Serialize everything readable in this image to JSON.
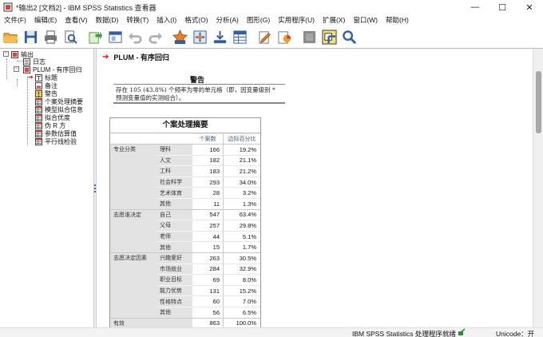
{
  "window": {
    "title": "*输出2 [文档2] - IBM SPSS Statistics 查看器",
    "minimize": "—",
    "maximize": "☐",
    "close": "✕"
  },
  "menu": [
    "文件(F)",
    "编辑(E)",
    "查看(V)",
    "数据(D)",
    "转换(T)",
    "插入(I)",
    "格式(O)",
    "分析(A)",
    "图形(G)",
    "实用程序(U)",
    "扩展(X)",
    "窗口(W)",
    "帮助(H)"
  ],
  "toolbar": [
    "open-icon",
    "save-icon",
    "print-icon",
    "print-preview-icon",
    "export-icon",
    "recall-dialog-icon",
    "undo-icon",
    "redo-icon",
    "goto-data-icon",
    "goto-variable-icon",
    "insert-cases-icon",
    "variables-icon",
    "designate-window-icon",
    "insert-chart-icon",
    "show-all-icon",
    "select-output-icon",
    "find-icon"
  ],
  "outline": {
    "root": "输出",
    "log": "日志",
    "plum": "PLUM - 有序回归",
    "items": [
      "标题",
      "备注",
      "警告",
      "个案处理摘要",
      "模型拟合信息",
      "拟合优度",
      "伪 R 方",
      "参数估算值",
      "平行线检验"
    ]
  },
  "content": {
    "heading": "PLUM - 有序回归",
    "warning_title": "警告",
    "warning_text": "存在 105 (43.8%) 个频率为零的单元格（即，因变量级别 * 预测变量值的实测组合）。",
    "table": {
      "title": "个案处理摘要",
      "col_n": "个案数",
      "col_pct": "边际百分比",
      "groups": [
        {
          "label": "专业分类",
          "rows": [
            [
              "理科",
              "166",
              "19.2%"
            ],
            [
              "人文",
              "182",
              "21.1%"
            ],
            [
              "工科",
              "183",
              "21.2%"
            ],
            [
              "社会科学",
              "293",
              "34.0%"
            ],
            [
              "艺术体育",
              "28",
              "3.2%"
            ],
            [
              "其他",
              "11",
              "1.3%"
            ]
          ]
        },
        {
          "label": "志愿谁决定",
          "rows": [
            [
              "自己",
              "547",
              "63.4%"
            ],
            [
              "父母",
              "257",
              "29.8%"
            ],
            [
              "老师",
              "44",
              "5.1%"
            ],
            [
              "其他",
              "15",
              "1.7%"
            ]
          ]
        },
        {
          "label": "志愿决定因素",
          "rows": [
            [
              "兴趣爱好",
              "263",
              "30.5%"
            ],
            [
              "市场就业",
              "284",
              "32.9%"
            ],
            [
              "职业目标",
              "69",
              "8.0%"
            ],
            [
              "能力优势",
              "131",
              "15.2%"
            ],
            [
              "性格特点",
              "60",
              "7.0%"
            ],
            [
              "其他",
              "56",
              "6.5%"
            ]
          ]
        }
      ],
      "valid_label": "有效",
      "valid_n": "863",
      "valid_pct": "100.0%"
    }
  },
  "status": {
    "text": "IBM SPSS Statistics 处理程序就绪",
    "unicode": "Unicode：开"
  }
}
